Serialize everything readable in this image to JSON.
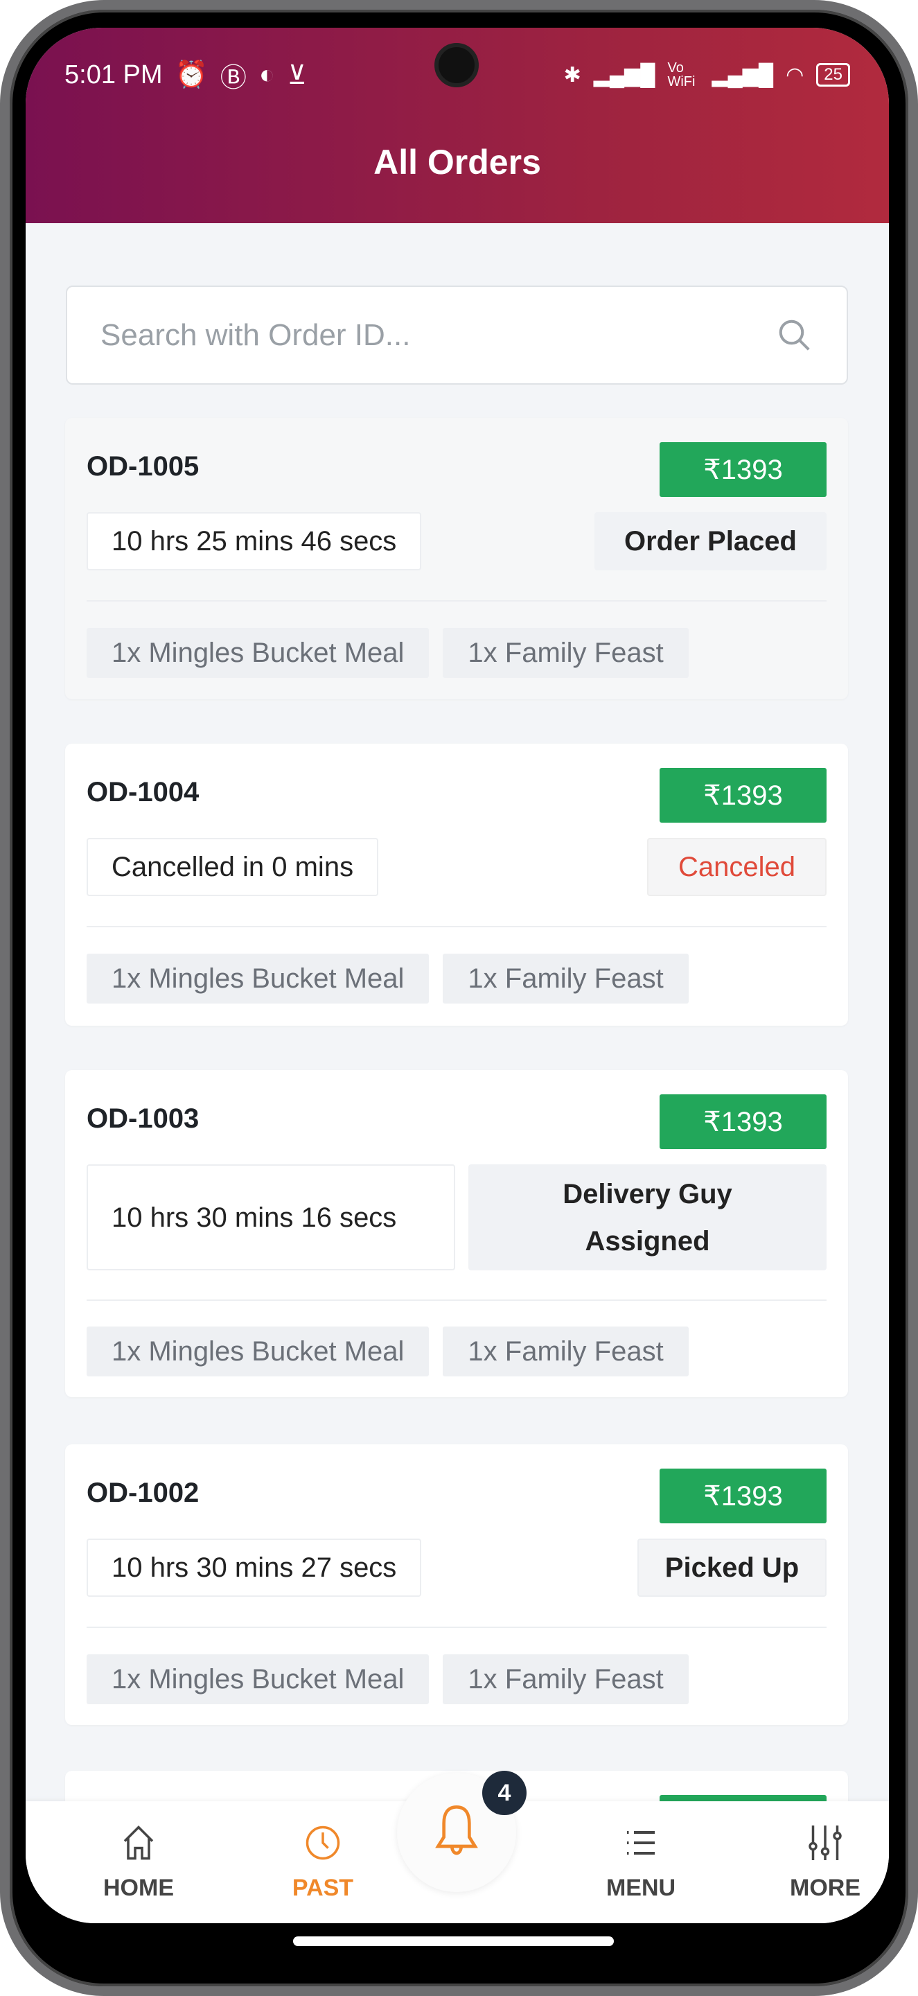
{
  "status_bar": {
    "time": "5:01 PM",
    "battery": "25",
    "network": "Vo WiFi"
  },
  "header": {
    "title": "All Orders"
  },
  "search": {
    "placeholder": "Search with Order ID..."
  },
  "orders": [
    {
      "id": "OD-1005",
      "price": "₹1393",
      "time": "10 hrs 25 mins 46 secs",
      "status": "Order Placed",
      "items": [
        "1x Mingles Bucket Meal",
        "1x Family Feast"
      ]
    },
    {
      "id": "OD-1004",
      "price": "₹1393",
      "time": "Cancelled in 0 mins",
      "status": "Canceled",
      "items": [
        "1x Mingles Bucket Meal",
        "1x Family Feast"
      ]
    },
    {
      "id": "OD-1003",
      "price": "₹1393",
      "time": "10 hrs 30 mins 16 secs",
      "status": "Delivery Guy Assigned",
      "items": [
        "1x Mingles Bucket Meal",
        "1x Family Feast"
      ]
    },
    {
      "id": "OD-1002",
      "price": "₹1393",
      "time": "10 hrs 30 mins 27 secs",
      "status": "Picked Up",
      "items": [
        "1x Mingles Bucket Meal",
        "1x Family Feast"
      ]
    }
  ],
  "nav": {
    "home": "HOME",
    "past": "PAST",
    "menu": "MENU",
    "more": "MORE",
    "notification_count": "4",
    "active": "past"
  },
  "colors": {
    "accent": "#f0882a",
    "price": "#22a75a",
    "canceled": "#e04a3a",
    "header_start": "#7a1150",
    "header_end": "#b12a3e"
  }
}
